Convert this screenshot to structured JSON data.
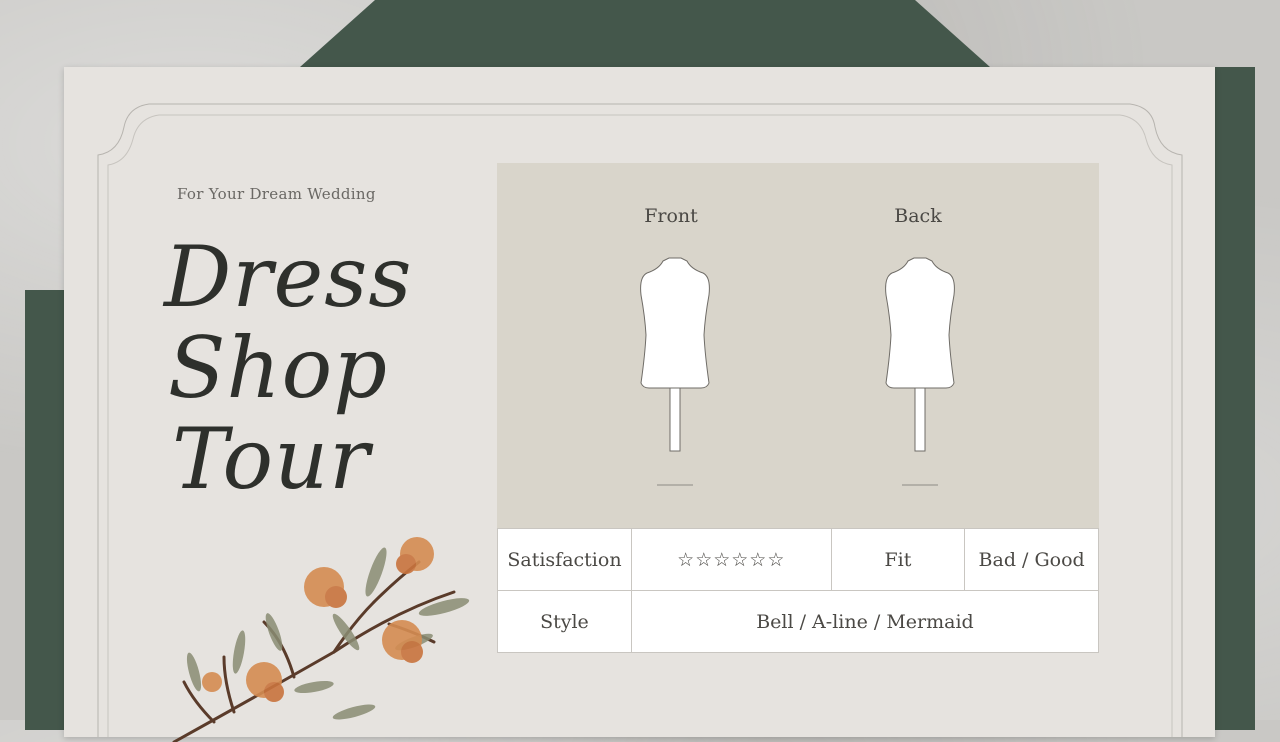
{
  "card": {
    "tagline": "For Your Dream Wedding",
    "title_lines": [
      "Dress",
      "Shop",
      "Tour"
    ]
  },
  "mannequins": {
    "front_label": "Front",
    "back_label": "Back"
  },
  "form": {
    "satisfaction_label": "Satisfaction",
    "satisfaction_stars": "☆☆☆☆☆☆",
    "fit_label": "Fit",
    "fit_value": "Bad / Good",
    "style_label": "Style",
    "style_value": "Bell / A-line / Mermaid"
  },
  "colors": {
    "envelope": "#44574b",
    "card": "#e6e3df",
    "panel": "#d9d5cb",
    "ink": "#2e302c"
  }
}
